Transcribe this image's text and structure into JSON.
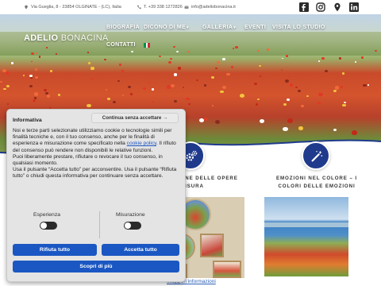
{
  "topbar": {
    "address": "Via Gueglia, 8 - 23854 OLGINATE - (LC), Italia",
    "phone": "T. +39 338 1272826",
    "email": "info@adeliobonacina.it",
    "social_icons": [
      "facebook-icon",
      "instagram-icon",
      "location-icon",
      "linkedin-icon"
    ]
  },
  "logo": {
    "first": "ADELIO ",
    "second": "BONACINA"
  },
  "nav": {
    "items": [
      {
        "label": "BIOGRAFIA",
        "dropdown": false
      },
      {
        "label": "DICONO DI ME",
        "dropdown": true
      },
      {
        "label": "GALLERIA",
        "dropdown": true
      },
      {
        "label": "EVENTI",
        "dropdown": false
      },
      {
        "label": "VISITA LO STUDIO",
        "dropdown": false
      },
      {
        "label": "CONTATTI",
        "dropdown": false
      }
    ],
    "language_flag": "italian-flag-icon"
  },
  "cards": [
    {
      "icon": "gears-icon",
      "title_line1": "ZIONE DELLE OPERE",
      "title_line2": "SU MISURA"
    },
    {
      "icon": "magic-wand-icon",
      "title_line1": "EMOZIONI NEL COLORE – I",
      "title_line2": "COLORI DELLE EMOZIONI"
    }
  ],
  "more_info_link": "Maggiori informazioni",
  "cookie_banner": {
    "title": "Informativa",
    "accept_without_label": "Continua senza accettare →",
    "text_before_link": "Noi e terze parti selezionate utilizziamo cookie o tecnologie simili per finalità tecniche e, con il tuo consenso, anche per le finalità di esperienza e misurazione come specificato nella ",
    "policy_link": "cookie policy",
    "text_after_link": ". Il rifiuto del consenso può rendere non disponibili le relative funzioni.",
    "paragraph2": "Puoi liberamente prestare, rifiutare o revocare il tuo consenso, in qualsiasi momento.",
    "paragraph3": "Usa il pulsante “Accetta tutto” per acconsentire. Usa il pulsante “Rifiuta tutto” o chiudi questa informativa per continuare senza accettare.",
    "toggles": [
      {
        "label": "Esperienza",
        "enabled": false
      },
      {
        "label": "Misurazione",
        "enabled": false
      }
    ],
    "reject_all": "Rifiuta tutto",
    "accept_all": "Accetta tutto",
    "learn_more": "Scopri di più"
  },
  "colors": {
    "accent_blue": "#1a57c3",
    "icon_circle": "#1f3a8c",
    "link_blue": "#2d5fb5",
    "poppy_red": "#d4542d"
  }
}
